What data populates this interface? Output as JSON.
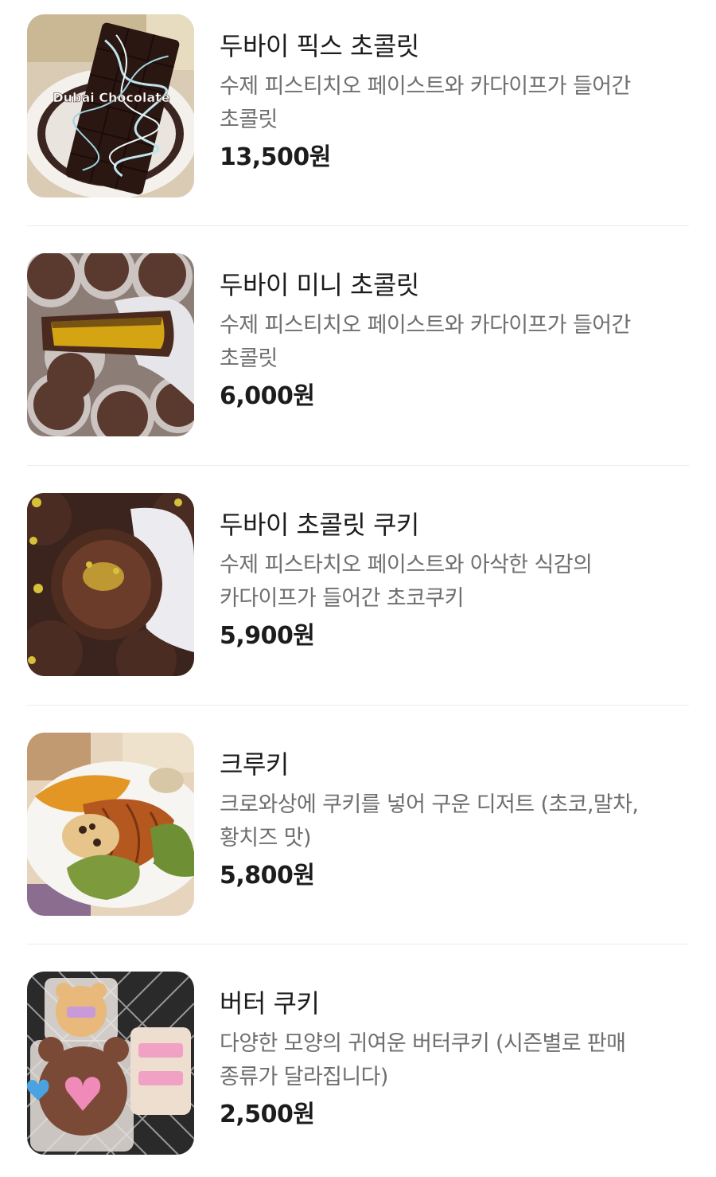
{
  "items": [
    {
      "name": "두바이 픽스 초콜릿",
      "description": "수제 피스티치오 페이스트와 카다이프가 들어간 초콜릿",
      "price": "13,500원",
      "photo_label": "Dubai Chocolate",
      "photo": "chocolate-bar-photo"
    },
    {
      "name": "두바이 미니 초콜릿",
      "description": "수제 피스티치오 페이스트와 카다이프가 들어간 초콜릿",
      "price": "6,000원",
      "photo": "mini-chocolate-photo"
    },
    {
      "name": "두바이 초콜릿 쿠키",
      "description": "수제 피스타치오 페이스트와 아삭한 식감의 카다이프가 들어간 초코쿠키",
      "price": "5,900원",
      "photo": "chocolate-cookie-photo"
    },
    {
      "name": "크루키",
      "description": "크로와상에 쿠키를 넣어 구운 디저트 (초코,말차, 황치즈 맛)",
      "price": "5,800원",
      "photo": "crookie-photo"
    },
    {
      "name": "버터 쿠키",
      "description": "다양한 모양의 귀여운 버터쿠키 (시즌별로 판매 종류가 달라집니다)",
      "price": "2,500원",
      "photo": "butter-cookie-photo"
    }
  ],
  "colors": {
    "name": "#1c1c1c",
    "description": "#6f6f6f",
    "divider": "#ececec"
  }
}
